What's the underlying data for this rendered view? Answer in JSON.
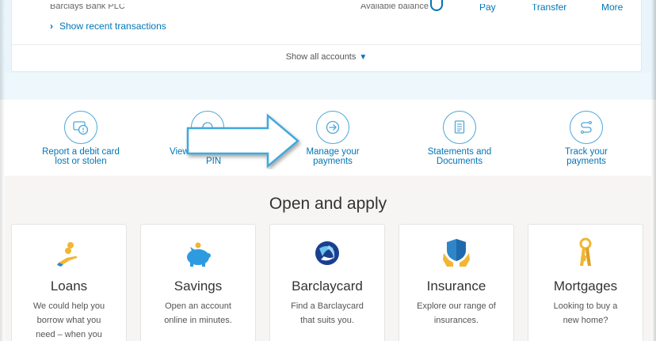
{
  "account": {
    "bank_name": "Barclays Bank PLC",
    "available_balance_label": "Available balance",
    "actions": [
      "Pay",
      "Transfer",
      "More"
    ],
    "recent_transactions_link": "Show recent transactions",
    "show_all_accounts": "Show all accounts"
  },
  "quick_actions": [
    {
      "label_line1": "Report a debit card",
      "label_line2": "lost or stolen",
      "icon": "card-alert-icon"
    },
    {
      "label_line1": "View",
      "label_line2": "PIN",
      "icon": "pin-icon"
    },
    {
      "label_line1": "Manage your",
      "label_line2": "payments",
      "icon": "arrow-right-circle-icon"
    },
    {
      "label_line1": "Statements and",
      "label_line2": "Documents",
      "icon": "document-icon"
    },
    {
      "label_line1": "Track your",
      "label_line2": "payments",
      "icon": "track-route-icon"
    }
  ],
  "open_apply": {
    "title": "Open and apply",
    "products": [
      {
        "title": "Loans",
        "desc1": "We could help you",
        "desc2": "borrow what you",
        "desc3": "need – when you",
        "icon": "coins-hand-icon"
      },
      {
        "title": "Savings",
        "desc1": "Open an account",
        "desc2": "online in minutes.",
        "desc3": "",
        "icon": "piggy-bank-icon"
      },
      {
        "title": "Barclaycard",
        "desc1": "Find a Barclaycard",
        "desc2": "that suits you.",
        "desc3": "",
        "icon": "barclaycard-logo-icon"
      },
      {
        "title": "Insurance",
        "desc1": "Explore our range of",
        "desc2": "insurances.",
        "desc3": "",
        "icon": "shield-hands-icon"
      },
      {
        "title": "Mortgages",
        "desc1": "Looking to buy a",
        "desc2": "new home?",
        "desc3": "",
        "icon": "keys-icon"
      }
    ]
  },
  "colors": {
    "brand_blue": "#0076b6",
    "icon_blue": "#4fa7d8",
    "arrow_fill": "#3fa9dd"
  }
}
